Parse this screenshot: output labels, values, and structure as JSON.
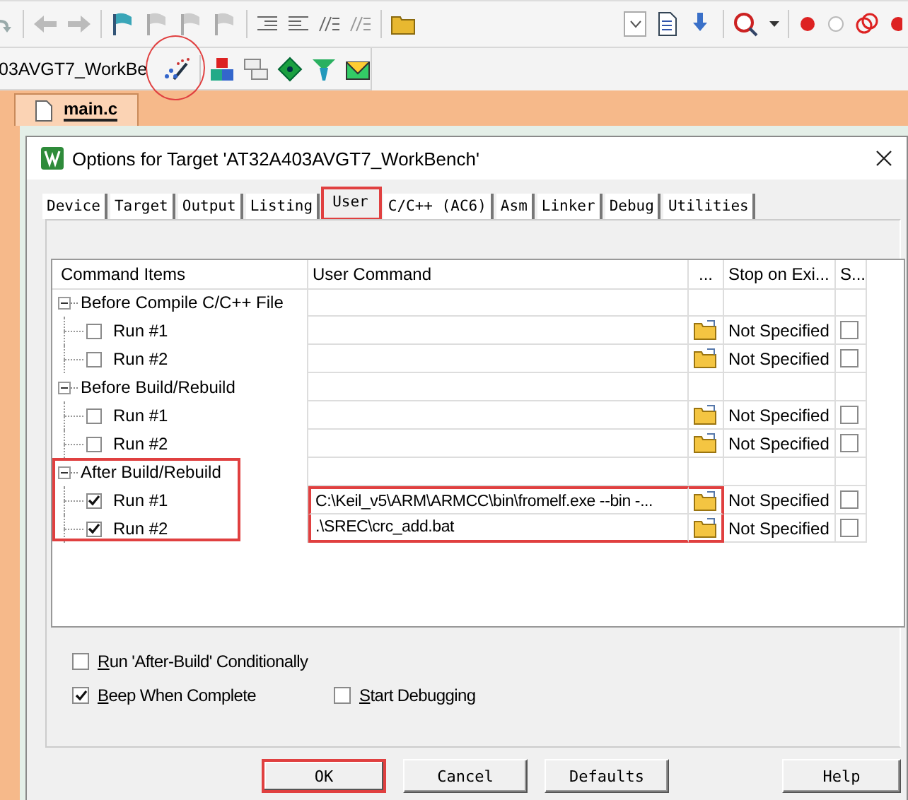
{
  "toolbar": {
    "target_combo": "03AVGT7_WorkBe",
    "options_button_highlighted": true
  },
  "editor_tabs": [
    {
      "label": "main.c",
      "selected": true
    }
  ],
  "dialog": {
    "title": "Options for Target 'AT32A403AVGT7_WorkBench'",
    "tabs": [
      {
        "label": "Device",
        "selected": false,
        "highlighted": false
      },
      {
        "label": "Target",
        "selected": false,
        "highlighted": false
      },
      {
        "label": "Output",
        "selected": false,
        "highlighted": false
      },
      {
        "label": "Listing",
        "selected": false,
        "highlighted": false
      },
      {
        "label": "User",
        "selected": true,
        "highlighted": true
      },
      {
        "label": "C/C++ (AC6)",
        "selected": false,
        "highlighted": false
      },
      {
        "label": "Asm",
        "selected": false,
        "highlighted": false
      },
      {
        "label": "Linker",
        "selected": false,
        "highlighted": false
      },
      {
        "label": "Debug",
        "selected": false,
        "highlighted": false
      },
      {
        "label": "Utilities",
        "selected": false,
        "highlighted": false
      }
    ],
    "table": {
      "columns": [
        "Command Items",
        "User Command",
        "...",
        "Stop on Exi...",
        "S..."
      ],
      "groups": [
        {
          "label": "Before Compile C/C++ File",
          "expanded": true,
          "highlighted": false,
          "commands_highlighted": false,
          "children": [
            {
              "label": "Run #1",
              "checked": false,
              "stop_on_exit": "Not Specified",
              "s_checked": false
            },
            {
              "label": "Run #2",
              "checked": false,
              "stop_on_exit": "Not Specified",
              "s_checked": false
            }
          ]
        },
        {
          "label": "Before Build/Rebuild",
          "expanded": true,
          "highlighted": false,
          "commands_highlighted": false,
          "children": [
            {
              "label": "Run #1",
              "checked": false,
              "stop_on_exit": "Not Specified",
              "s_checked": false
            },
            {
              "label": "Run #2",
              "checked": false,
              "stop_on_exit": "Not Specified",
              "s_checked": false
            }
          ]
        },
        {
          "label": "After Build/Rebuild",
          "expanded": true,
          "highlighted": true,
          "commands_highlighted": true,
          "children": [
            {
              "label": "Run #1",
              "checked": true,
              "command": "C:\\Keil_v5\\ARM\\ARMCC\\bin\\fromelf.exe --bin -...",
              "stop_on_exit": "Not Specified",
              "s_checked": false
            },
            {
              "label": "Run #2",
              "checked": true,
              "command": ".\\SREC\\crc_add.bat",
              "stop_on_exit": "Not Specified",
              "s_checked": false
            }
          ]
        }
      ]
    },
    "options": [
      {
        "label": "Run 'After-Build' Conditionally",
        "checked": false
      },
      {
        "label": "Beep When Complete",
        "checked": true
      },
      {
        "label": "Start Debugging",
        "checked": false
      }
    ],
    "buttons": [
      {
        "label": "OK",
        "highlighted": true
      },
      {
        "label": "Cancel",
        "highlighted": false
      },
      {
        "label": "Defaults",
        "highlighted": false
      },
      {
        "label": "Help",
        "highlighted": false
      }
    ]
  }
}
